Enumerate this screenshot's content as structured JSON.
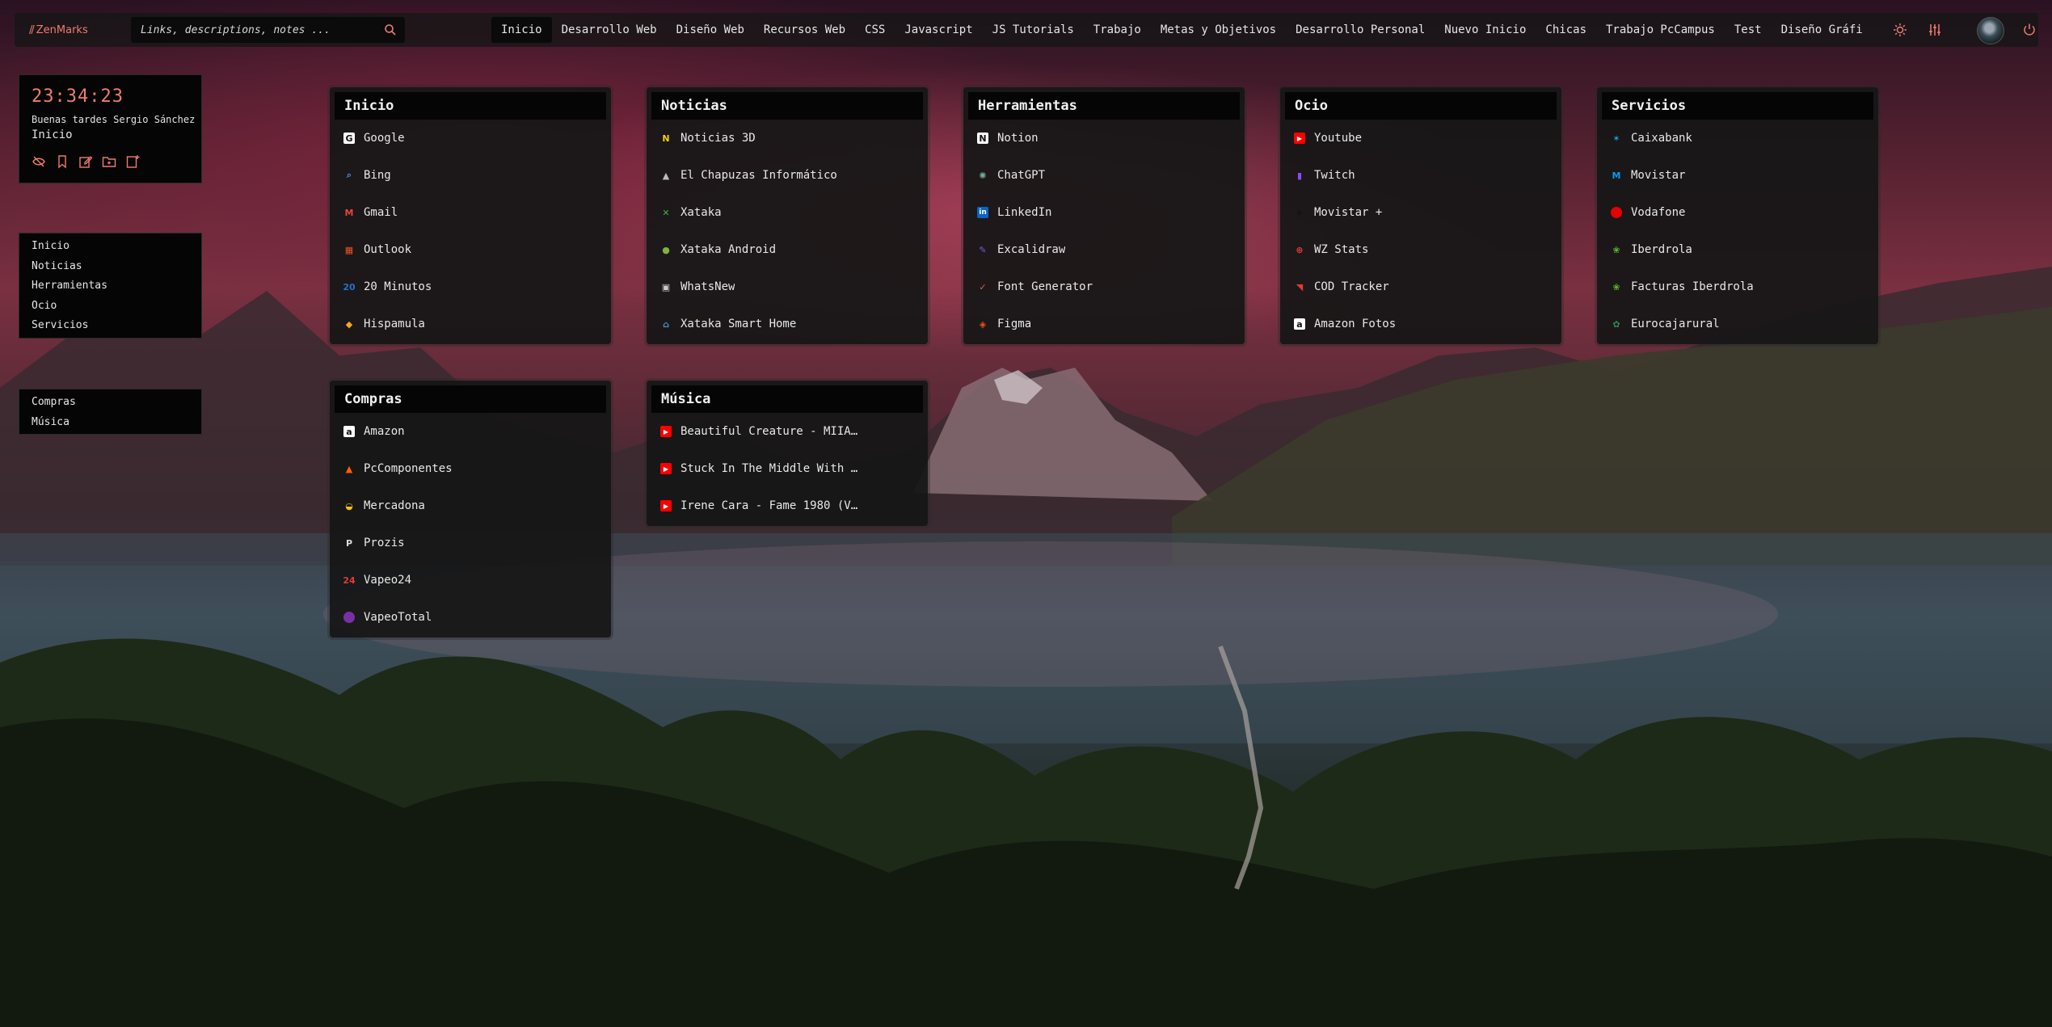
{
  "brand": {
    "name": "ZenMarks"
  },
  "search": {
    "placeholder": "Links, descriptions, notes ..."
  },
  "nav": {
    "tabs": [
      "Inicio",
      "Desarrollo Web",
      "Diseño Web",
      "Recursos Web",
      "CSS",
      "Javascript",
      "JS Tutorials",
      "Trabajo",
      "Metas y Objetivos",
      "Desarrollo Personal",
      "Nuevo Inicio",
      "Chicas",
      "Trabajo PcCampus",
      "Test",
      "Diseño Gráfi"
    ],
    "active": "Inicio"
  },
  "toolbar": {
    "icons": [
      "sun-icon",
      "sliders-icon",
      "avatar",
      "power-icon"
    ]
  },
  "clock": {
    "time": "23:34:23",
    "greeting": "Buenas tardes Sergio Sánchez",
    "page": "Inicio",
    "actions": [
      "eye-off-icon",
      "bookmark-icon",
      "edit-icon",
      "folder-icon",
      "new-page-icon"
    ]
  },
  "sidebar": {
    "groups": [
      {
        "items": [
          "Inicio",
          "Noticias",
          "Herramientas",
          "Ocio",
          "Servicios"
        ]
      },
      {
        "items": [
          "Compras",
          "Música"
        ]
      }
    ]
  },
  "cards": [
    {
      "title": "Inicio",
      "links": [
        {
          "label": "Google",
          "icon": "google-icon",
          "color": "#ffffff"
        },
        {
          "label": "Bing",
          "icon": "search-icon",
          "color": "#4a90d9"
        },
        {
          "label": "Gmail",
          "icon": "gmail-icon",
          "color": "#ea4335"
        },
        {
          "label": "Outlook",
          "icon": "windows-icon",
          "color": "#f25022"
        },
        {
          "label": "20 Minutos",
          "icon": "20minutos-icon",
          "color": "#1f74c9"
        },
        {
          "label": "Hispamula",
          "icon": "hispamula-icon",
          "color": "#f5a623"
        }
      ]
    },
    {
      "title": "Noticias",
      "links": [
        {
          "label": "Noticias 3D",
          "icon": "n3d-icon",
          "color": "#f7d000"
        },
        {
          "label": "El Chapuzas Informático",
          "icon": "chapuzas-icon",
          "color": "#bbbbbb"
        },
        {
          "label": "Xataka",
          "icon": "xataka-icon",
          "color": "#38b24a"
        },
        {
          "label": "Xataka Android",
          "icon": "android-icon",
          "color": "#7cb342"
        },
        {
          "label": "WhatsNew",
          "icon": "whatsnew-icon",
          "color": "#cccccc"
        },
        {
          "label": "Xataka Smart Home",
          "icon": "smarthome-icon",
          "color": "#4a8fd6"
        }
      ]
    },
    {
      "title": "Herramientas",
      "links": [
        {
          "label": "Notion",
          "icon": "notion-icon",
          "color": "#ffffff"
        },
        {
          "label": "ChatGPT",
          "icon": "chatgpt-icon",
          "color": "#74aa9c"
        },
        {
          "label": "LinkedIn",
          "icon": "linkedin-icon",
          "color": "#0a66c2"
        },
        {
          "label": "Excalidraw",
          "icon": "excalidraw-icon",
          "color": "#6965db"
        },
        {
          "label": "Font Generator",
          "icon": "check-icon",
          "color": "#e05a4f"
        },
        {
          "label": "Figma",
          "icon": "figma-icon",
          "color": "#f24e1e"
        }
      ]
    },
    {
      "title": "Ocio",
      "links": [
        {
          "label": "Youtube",
          "icon": "youtube-icon",
          "color": "#ff0000"
        },
        {
          "label": "Twitch",
          "icon": "twitch-icon",
          "color": "#9146ff"
        },
        {
          "label": "Movistar +",
          "icon": "plus-icon",
          "color": "#111111"
        },
        {
          "label": "WZ Stats",
          "icon": "crosshair-icon",
          "color": "#e53935"
        },
        {
          "label": "COD Tracker",
          "icon": "cod-icon",
          "color": "#e53935"
        },
        {
          "label": "Amazon Fotos",
          "icon": "amazon-icon",
          "color": "#ffffff"
        }
      ]
    },
    {
      "title": "Servicios",
      "links": [
        {
          "label": "Caixabank",
          "icon": "caixabank-icon",
          "color": "#1aa3e0"
        },
        {
          "label": "Movistar",
          "icon": "movistar-icon",
          "color": "#019df4"
        },
        {
          "label": "Vodafone",
          "icon": "vodafone-icon",
          "color": "#e60000"
        },
        {
          "label": "Iberdrola",
          "icon": "iberdrola-icon",
          "color": "#5cb531"
        },
        {
          "label": "Facturas Iberdrola",
          "icon": "iberdrola-icon",
          "color": "#5cb531"
        },
        {
          "label": "Eurocajarural",
          "icon": "eurocaja-icon",
          "color": "#2e8b57"
        }
      ]
    },
    {
      "title": "Compras",
      "links": [
        {
          "label": "Amazon",
          "icon": "amazon-icon",
          "color": "#ffffff"
        },
        {
          "label": "PcComponentes",
          "icon": "pccomponentes-icon",
          "color": "#ff6000"
        },
        {
          "label": "Mercadona",
          "icon": "mercadona-icon",
          "color": "#f5c400"
        },
        {
          "label": "Prozis",
          "icon": "prozis-icon",
          "color": "#dddddd"
        },
        {
          "label": "Vapeo24",
          "icon": "vapeo24-icon",
          "color": "#e53935"
        },
        {
          "label": "VapeoTotal",
          "icon": "vapeototal-icon",
          "color": "#7b2fa5"
        }
      ]
    },
    {
      "title": "Música",
      "links": [
        {
          "label": "Beautiful Creature - MIIA …",
          "icon": "youtube-icon",
          "color": "#ff0000"
        },
        {
          "label": "Stuck In The Middle With Y…",
          "icon": "youtube-icon",
          "color": "#ff0000"
        },
        {
          "label": "Irene Cara - Fame 1980 (VH…",
          "icon": "youtube-icon",
          "color": "#ff0000"
        }
      ]
    }
  ]
}
